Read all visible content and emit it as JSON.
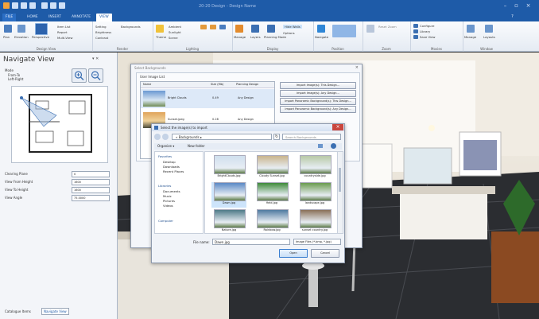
{
  "app": {
    "title": "20-20 Design - Design Name",
    "tabs": [
      "FILE",
      "HOME",
      "INSERT",
      "ANNOTATE",
      "VIEW"
    ],
    "active_tab": "VIEW"
  },
  "ribbon": {
    "groups": [
      {
        "label": "Design View",
        "items": [
          "Plan",
          "Elevation",
          "Perspective",
          "Item List",
          "Report",
          "Multi-View"
        ]
      },
      {
        "label": "Render",
        "items": [
          "Setting",
          "Brightness",
          "Contrast",
          "Backgrounds"
        ]
      },
      {
        "label": "Lighting",
        "items": [
          "Theme",
          "Ambient",
          "Sunlight",
          "Scene"
        ]
      },
      {
        "label": "Display",
        "items": [
          "Manage",
          "Layers",
          "Planning Mode",
          "Hide Walls",
          "Options"
        ]
      },
      {
        "label": "Position",
        "items": [
          "Navigate"
        ]
      },
      {
        "label": "Zoom",
        "items": [
          "Reset Zoom"
        ]
      },
      {
        "label": "Movies",
        "items": [
          "Configure",
          "Library",
          "Save View"
        ]
      },
      {
        "label": "Window",
        "items": [
          "Manage",
          "Layouts"
        ]
      }
    ]
  },
  "left_panel": {
    "title": "Navigate View",
    "mode_label": "Mode",
    "mode_options": [
      "From-To",
      "Left-Right"
    ],
    "fields": [
      {
        "label": "Clearing Plane",
        "value": "0"
      },
      {
        "label": "View From Height",
        "value": "1600"
      },
      {
        "label": "View To Height",
        "value": "1600"
      },
      {
        "label": "View Angle",
        "value": "75.0000"
      }
    ],
    "bottom_tabs": [
      "Catalogue Items",
      "Navigate View"
    ]
  },
  "image_manager": {
    "title": "Select Backgrounds",
    "list_title": "User Image List",
    "columns": [
      "Name",
      "Size (Mb)",
      "Planning Design"
    ],
    "rows": [
      {
        "name": "Bright Clouds",
        "size": "0.49",
        "design": "Any Design"
      },
      {
        "name": "Sunset.jpeg",
        "size": "0.28",
        "design": "Any Design"
      }
    ],
    "buttons": [
      "Import Image(s): This Design...",
      "Import Image(s): Any Design...",
      "Import Panoramic Background(s): This Design...",
      "Import Panoramic Background(s): Any Design..."
    ]
  },
  "file_dialog": {
    "title": "Select the image(s) to import",
    "path": "« Backgrounds ▸",
    "search_placeholder": "Search Backgrounds",
    "organize": "Organize ▾",
    "new_folder": "New folder",
    "nav_favorites": "Favorites",
    "nav_items_fav": [
      "Desktop",
      "Downloads",
      "Recent Places"
    ],
    "nav_libraries": "Libraries",
    "nav_items_lib": [
      "Documents",
      "Music",
      "Pictures",
      "Videos"
    ],
    "nav_computer": "Computer",
    "thumbnails": [
      {
        "name": "BrightClouds.jpg",
        "color": "#cfdfee"
      },
      {
        "name": "Cloudy Sunset.jpg",
        "color": "#c9b48c"
      },
      {
        "name": "countryside.jpg",
        "color": "#b7c9a5"
      },
      {
        "name": "Dawn.jpg",
        "color": "#5a89c6"
      },
      {
        "name": "field.jpg",
        "color": "#3f8a3a"
      },
      {
        "name": "landscape.jpg",
        "color": "#6a9a4e"
      },
      {
        "name": "Nature.jpg",
        "color": "#4e7a88"
      },
      {
        "name": "Rainbow.jpg",
        "color": "#4f7aa0"
      },
      {
        "name": "sunset country.jpg",
        "color": "#8a7058"
      }
    ],
    "filename_label": "File name:",
    "filename_value": "Dawn.jpg",
    "filter_value": "Image Files (*.bmp, *.jpg)",
    "open_label": "Open",
    "cancel_label": "Cancel"
  },
  "colors": {
    "accent": "#1e5ba8",
    "ribbon": "#eef2f8",
    "selection": "#cde4fb"
  }
}
